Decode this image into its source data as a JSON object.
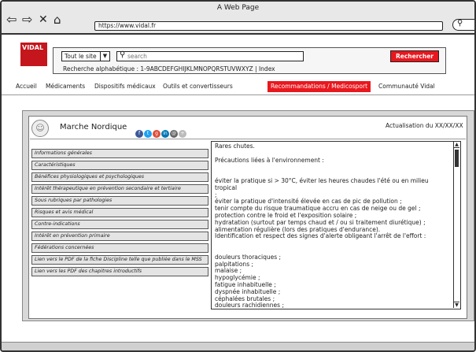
{
  "browser": {
    "title": "A Web Page",
    "url": "https://www.vidal.fr"
  },
  "header": {
    "logo_text": "VIDAL",
    "scope_select": "Tout le site",
    "search_placeholder": "search",
    "search_button": "Rechercher",
    "alpha_index": "Recherche alphabétique : 1-9ABCDEFGHIJKLMNOPQRSTUVWXYZ | Index"
  },
  "nav": {
    "items": [
      {
        "label": "Accueil"
      },
      {
        "label": "Médicaments"
      },
      {
        "label": "Dispositifs médicaux"
      },
      {
        "label": "Outils et convertisseurs"
      },
      {
        "label": "Recommandations / Medicosport"
      },
      {
        "label": "Communauté Vidal"
      }
    ]
  },
  "doc": {
    "title": "Marche Nordique",
    "update": "Actualisation du XX/XX/XX"
  },
  "menu": {
    "items": [
      "Informations générales",
      "Caractéristiques",
      "Bénéfices physiologiques et psychologiques",
      "Intérêt thérapeutique en prévention secondaire et tertiaire",
      "Sous rubriques par pathologies",
      "Risques et avis médical",
      "Contre-indications",
      "Intérêt en prévention primaire",
      "Fédérations concernées",
      "Lien vers le PDF de la fiche Discipline telle que publiée dans le MSS",
      "Lien vers les PDF des chapitres introductifs"
    ]
  },
  "pane": {
    "lines": [
      "Rares chutes.",
      "",
      "Précautions liées à l'environnement :",
      "",
      "",
      "éviter la pratique si > 30°C, éviter les heures chaudes l'été ou en milieu tropical",
      ";",
      "éviter la pratique d'intensité élevée en cas de pic de pollution ;",
      "tenir compte du risque traumatique accru en cas de neige ou de gel ;",
      "protection contre le froid et l'exposition solaire ;",
      "hydratation (surtout par temps chaud et / ou si traitement diurétique) ;",
      "alimentation régulière (lors des pratiques d'endurance).",
      "Identification et respect des signes d'alerte obligeant l'arrêt de l'effort :",
      "",
      "",
      "douleurs thoraciques ;",
      "palpitations ;",
      "malaise ;",
      "hypoglycémie ;",
      "fatigue inhabituelle ;",
      "dyspnée inhabituelle ;",
      "céphalées brutales ;",
      "douleurs rachidiennes ;"
    ]
  }
}
